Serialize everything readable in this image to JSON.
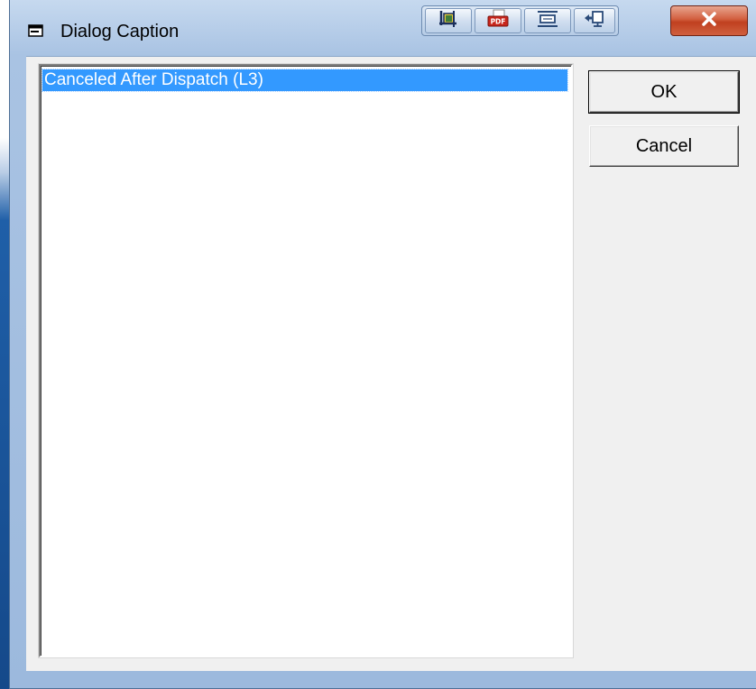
{
  "window": {
    "title": "Dialog Caption",
    "title_icon": "dialog-window-icon"
  },
  "toolbar": {
    "buttons": [
      {
        "name": "crop-icon"
      },
      {
        "name": "pdf-icon"
      },
      {
        "name": "fit-window-icon"
      },
      {
        "name": "send-to-screen-icon"
      }
    ],
    "close_glyph": "x"
  },
  "list": {
    "items": [
      {
        "label": "Canceled After Dispatch (L3)",
        "selected": true
      }
    ]
  },
  "buttons": {
    "ok_label": "OK",
    "cancel_label": "Cancel"
  },
  "colors": {
    "selection": "#3399ff",
    "close_button": "#c94a2a",
    "dialog_face": "#f0f0f0"
  }
}
